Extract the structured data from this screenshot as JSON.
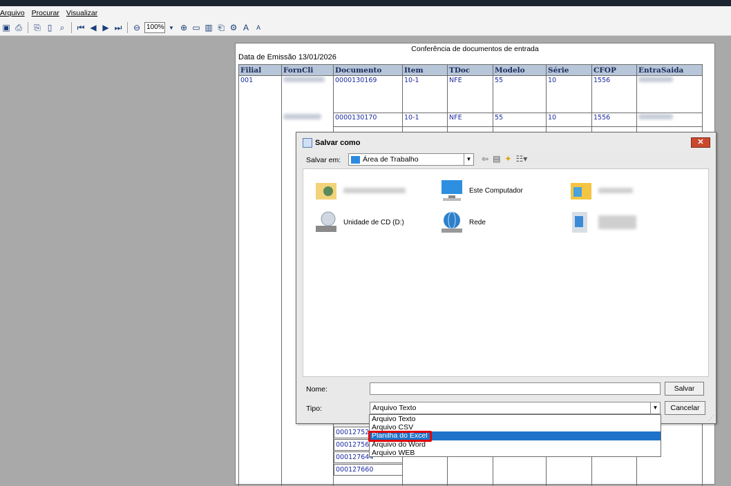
{
  "menu": [
    "Arquivo",
    "Procurar",
    "Visualizar"
  ],
  "toolbar": {
    "zoom": "100%"
  },
  "report": {
    "title": "Conferência de documentos de entrada",
    "emissao": "Data de Emissão 13/01/2026",
    "columns": [
      "Filial",
      "FornCli",
      "Documento",
      "Item",
      "TDoc",
      "Modelo",
      "Série",
      "CFOP",
      "EntraSaida"
    ],
    "rows": [
      {
        "filial": "001",
        "documento": "0000130169",
        "item": "10-1",
        "tdoc": "NFE",
        "modelo": "55",
        "serie": "10",
        "cfop": "1556"
      },
      {
        "filial": "",
        "documento": "0000130170",
        "item": "10-1",
        "tdoc": "NFE",
        "modelo": "55",
        "serie": "10",
        "cfop": "1556"
      }
    ],
    "lower_docs": [
      "000127523",
      "000127565",
      "000127644",
      "000127660"
    ]
  },
  "dialog": {
    "title": "Salvar como",
    "save_in_label": "Salvar em:",
    "save_in_value": "Área de Trabalho",
    "items": [
      {
        "label": "",
        "icon": "user-folder-icon"
      },
      {
        "label": "Este Computador",
        "icon": "computer-icon"
      },
      {
        "label": "",
        "icon": "library-folder-icon"
      },
      {
        "label": "Unidade de CD (D:)",
        "icon": "cd-drive-icon"
      },
      {
        "label": "Rede",
        "icon": "network-icon"
      },
      {
        "label": "",
        "icon": "folder-icon"
      }
    ],
    "name_label": "Nome:",
    "name_value": "",
    "type_label": "Tipo:",
    "type_value": "Arquivo Texto",
    "save_button": "Salvar",
    "cancel_button": "Cancelar",
    "type_options": [
      "Arquivo Texto",
      "Arquivo CSV",
      "Planilha do Excel",
      "Arquivo do Word",
      "Arquivo WEB"
    ],
    "selected_option": "Planilha do Excel"
  }
}
